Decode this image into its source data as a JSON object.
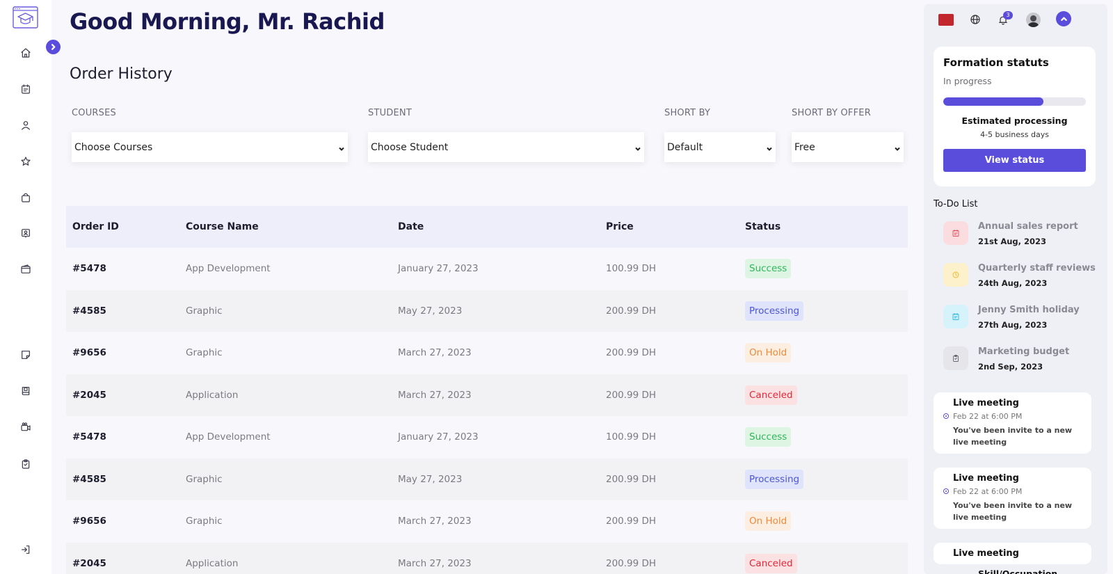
{
  "greeting": "Good Morning, Mr. Rachid",
  "section_title": "Order History",
  "filters": [
    {
      "label": "COURSES",
      "value": "Choose Courses"
    },
    {
      "label": "STUDENT",
      "value": "Choose Student"
    },
    {
      "label": "SHORT BY",
      "value": "Default"
    },
    {
      "label": "SHORT BY OFFER",
      "value": "Free"
    }
  ],
  "table": {
    "headers": [
      "Order ID",
      "Course Name",
      "Date",
      "Price",
      "Status"
    ],
    "rows": [
      {
        "id": "#5478",
        "course": "App Development",
        "date": "January 27, 2023",
        "price": "100.99 DH",
        "status": "Success"
      },
      {
        "id": "#4585",
        "course": "Graphic",
        "date": "May 27, 2023",
        "price": "200.99 DH",
        "status": "Processing"
      },
      {
        "id": "#9656",
        "course": "Graphic",
        "date": "March 27, 2023",
        "price": "200.99 DH",
        "status": "On Hold"
      },
      {
        "id": "#2045",
        "course": "Application",
        "date": "March 27, 2023",
        "price": "200.99 DH",
        "status": "Canceled"
      },
      {
        "id": "#5478",
        "course": "App Development",
        "date": "January 27, 2023",
        "price": "100.99 DH",
        "status": "Success"
      },
      {
        "id": "#4585",
        "course": "Graphic",
        "date": "May 27, 2023",
        "price": "200.99 DH",
        "status": "Processing"
      },
      {
        "id": "#9656",
        "course": "Graphic",
        "date": "March 27, 2023",
        "price": "200.99 DH",
        "status": "On Hold"
      },
      {
        "id": "#2045",
        "course": "Application",
        "date": "March 27, 2023",
        "price": "200.99 DH",
        "status": "Canceled"
      }
    ]
  },
  "status_colors": {
    "Success": "#2fb55a",
    "Processing": "#4a56d6",
    "On Hold": "#ef8a3a",
    "Canceled": "#e02838"
  },
  "accent_color": "#5b4ddb",
  "topbar": {
    "flag_color": "#c1272d",
    "notification_count": "3"
  },
  "formation": {
    "title": "Formation statuts",
    "subtitle": "In progress",
    "progress_fraction": 0.7,
    "estimated_title": "Estimated processing",
    "estimated_sub": "4-5 business days",
    "button": "View status"
  },
  "todo": {
    "title": "To-Do List",
    "items": [
      {
        "name": "Annual sales report",
        "date": "21st Aug, 2023",
        "icon": "calendar-icon",
        "bg": "#fbdde0",
        "color": "#e84a5a"
      },
      {
        "name": "Quarterly staff reviews",
        "date": "24th Aug, 2023",
        "icon": "clock-icon",
        "bg": "#fdf1cc",
        "color": "#f0b429"
      },
      {
        "name": "Jenny Smith holiday",
        "date": "27th Aug, 2023",
        "icon": "calendar-icon",
        "bg": "#d6f3fb",
        "color": "#27b4e0"
      },
      {
        "name": "Marketing budget",
        "date": "2nd Sep, 2023",
        "icon": "clipboard-icon",
        "bg": "#e6e6ea",
        "color": "#666670"
      }
    ]
  },
  "meetings": [
    {
      "title": "Live meeting",
      "time": "Feb 22 at 6:00 PM",
      "desc": "You've been invite to a new live meeting"
    },
    {
      "title": "Live meeting",
      "time": "Feb 22 at 6:00 PM",
      "desc": "You've been invite to a new live meeting"
    },
    {
      "title": "Live meeting",
      "time": "",
      "desc": ""
    }
  ],
  "skill_label": "Skill/Occupation"
}
